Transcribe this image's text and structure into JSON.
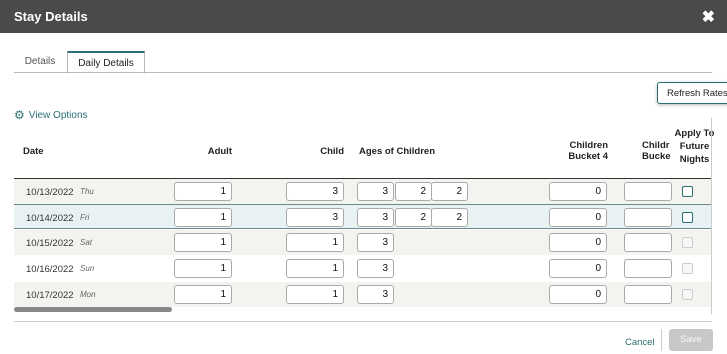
{
  "window": {
    "title": "Stay Details",
    "close_icon": "close-icon"
  },
  "tabs": [
    {
      "label": "Details"
    },
    {
      "label": "Daily Details"
    }
  ],
  "refresh_label": "Refresh Rates",
  "view_options_label": "View Options",
  "columns": {
    "date": "Date",
    "adult": "Adult",
    "child": "Child",
    "ages": "Ages of Children",
    "bucket4": "Children Bucket 4",
    "bucket5": "Childr Bucke",
    "apply": "Apply To Future Nights"
  },
  "rows": [
    {
      "date": "10/13/2022",
      "day": "Thu",
      "adult": "1",
      "child": "3",
      "ages": [
        "3",
        "2",
        "2"
      ],
      "bucket4": "0",
      "bucket5": "",
      "apply_enabled": true
    },
    {
      "date": "10/14/2022",
      "day": "Fri",
      "adult": "1",
      "child": "3",
      "ages": [
        "3",
        "2",
        "2"
      ],
      "bucket4": "0",
      "bucket5": "",
      "apply_enabled": true
    },
    {
      "date": "10/15/2022",
      "day": "Sat",
      "adult": "1",
      "child": "1",
      "ages": [
        "3"
      ],
      "bucket4": "0",
      "bucket5": "",
      "apply_enabled": false
    },
    {
      "date": "10/16/2022",
      "day": "Sun",
      "adult": "1",
      "child": "1",
      "ages": [
        "3"
      ],
      "bucket4": "0",
      "bucket5": "",
      "apply_enabled": false
    },
    {
      "date": "10/17/2022",
      "day": "Mon",
      "adult": "1",
      "child": "1",
      "ages": [
        "3"
      ],
      "bucket4": "0",
      "bucket5": "",
      "apply_enabled": false
    }
  ],
  "footer": {
    "cancel_label": "Cancel",
    "save_label": "Save"
  },
  "colors": {
    "accent": "#2a6f73",
    "titlebar": "#4a4a48"
  }
}
